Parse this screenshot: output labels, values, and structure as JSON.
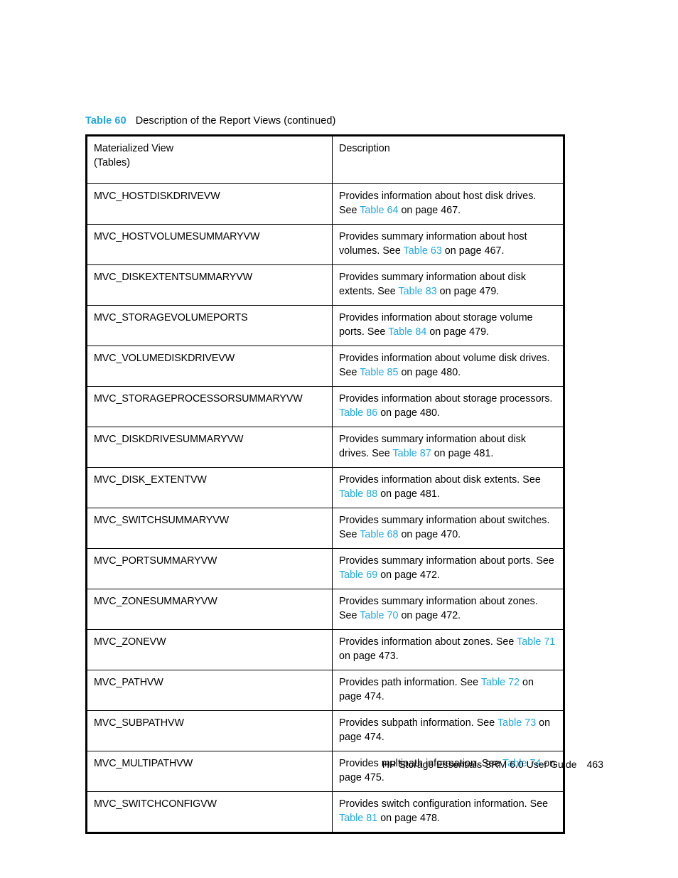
{
  "caption": {
    "label": "Table 60",
    "text": "Description of the Report Views (continued)"
  },
  "colors": {
    "accent": "#21A8E0",
    "text": "#000000",
    "border": "#000000"
  },
  "table": {
    "headers": {
      "col1_line1": "Materialized View",
      "col1_line2": "(Tables)",
      "col2": "Description"
    },
    "rows": [
      {
        "view": "MVC_HOSTDISKDRIVEVW",
        "desc_pre": "Provides information about host disk drives. See ",
        "xref": "Table 64",
        "desc_post": " on page 467."
      },
      {
        "view": "MVC_HOSTVOLUMESUMMARYVW",
        "desc_pre": "Provides summary information about host volumes. See ",
        "xref": "Table 63",
        "desc_post": " on page 467."
      },
      {
        "view": "MVC_DISKEXTENTSUMMARYVW",
        "desc_pre": "Provides summary information about disk extents. See ",
        "xref": "Table 83",
        "desc_post": " on page 479."
      },
      {
        "view": "MVC_STORAGEVOLUMEPORTS",
        "desc_pre": "Provides information about storage volume ports. See ",
        "xref": "Table 84",
        "desc_post": " on page 479."
      },
      {
        "view": "MVC_VOLUMEDISKDRIVEVW",
        "desc_pre": "Provides information about volume disk drives. See ",
        "xref": "Table 85",
        "desc_post": " on page 480."
      },
      {
        "view": "MVC_STORAGEPROCESSORSUMMARYVW",
        "desc_pre": "Provides information about storage processors. ",
        "xref": "Table 86",
        "desc_post": " on page 480."
      },
      {
        "view": "MVC_DISKDRIVESUMMARYVW",
        "desc_pre": "Provides summary information about disk drives. See ",
        "xref": "Table 87",
        "desc_post": " on page 481."
      },
      {
        "view": "MVC_DISK_EXTENTVW",
        "desc_pre": "Provides information about disk extents. See ",
        "xref": "Table 88",
        "desc_post": " on page 481."
      },
      {
        "view": "MVC_SWITCHSUMMARYVW",
        "desc_pre": "Provides summary information about switches. See ",
        "xref": "Table 68",
        "desc_post": " on page 470."
      },
      {
        "view": "MVC_PORTSUMMARYVW",
        "desc_pre": "Provides summary information about ports. See ",
        "xref": "Table 69",
        "desc_post": " on page 472."
      },
      {
        "view": "MVC_ZONESUMMARYVW",
        "desc_pre": "Provides summary information about zones. See ",
        "xref": "Table 70",
        "desc_post": " on page 472."
      },
      {
        "view": "MVC_ZONEVW",
        "desc_pre": "Provides information about zones. See ",
        "xref": "Table 71",
        "desc_post": " on page 473."
      },
      {
        "view": "MVC_PATHVW",
        "desc_pre": "Provides path information. See ",
        "xref": "Table 72",
        "desc_post": " on page 474."
      },
      {
        "view": "MVC_SUBPATHVW",
        "desc_pre": "Provides subpath information. See ",
        "xref": "Table 73",
        "desc_post": " on page 474."
      },
      {
        "view": "MVC_MULTIPATHVW",
        "desc_pre": "Provides multipath information. See ",
        "xref": "Table 74",
        "desc_post": " on page 475."
      },
      {
        "view": "MVC_SWITCHCONFIGVW",
        "desc_pre": "Provides switch configuration information. See ",
        "xref": "Table 81",
        "desc_post": " on page 478."
      }
    ]
  },
  "footer": {
    "guide_title": "HP Storage Essentials SRM 6.0 User Guide",
    "page_number": "463"
  }
}
